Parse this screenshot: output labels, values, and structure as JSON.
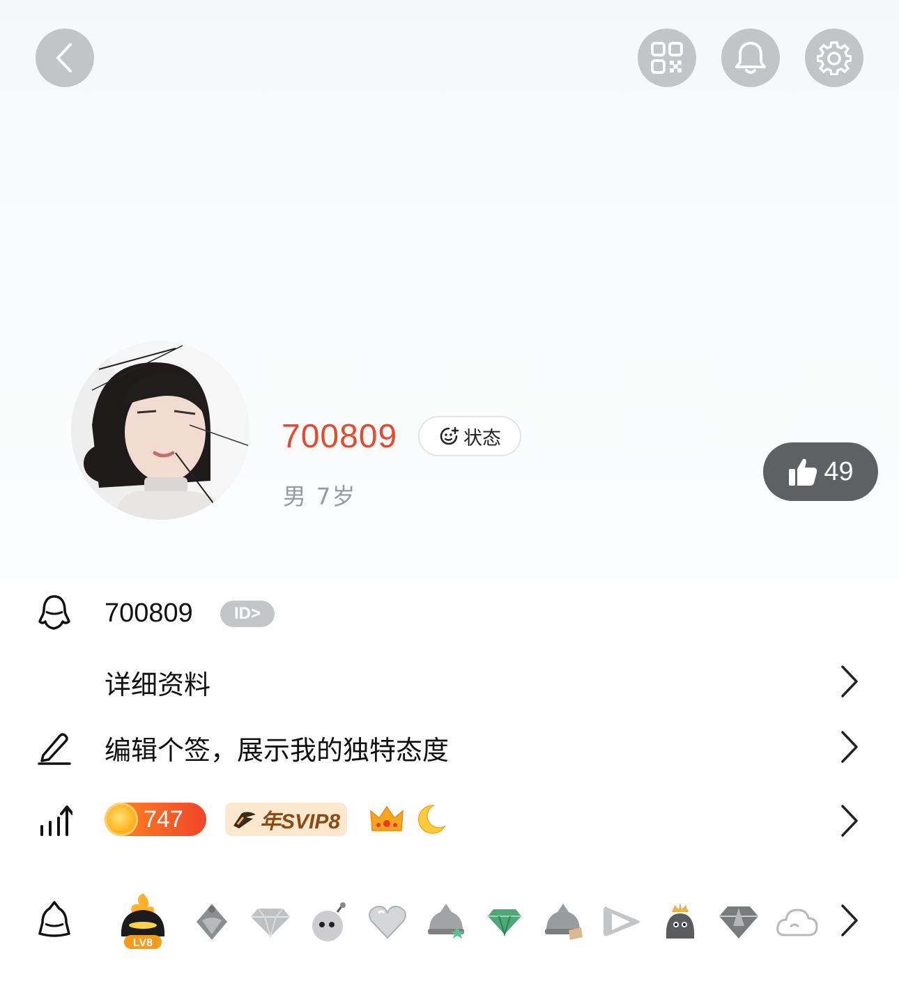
{
  "profile": {
    "nickname": "700809",
    "status_label": "状态",
    "gender_age": "男  7岁",
    "likes": "49"
  },
  "account": {
    "qq_number": "700809",
    "id_badge": "ID>"
  },
  "menu": {
    "details_label": "详细资料",
    "signature_placeholder": "编辑个签，展示我的独特态度"
  },
  "level": {
    "value": "747",
    "svip_label": "年SVIP8"
  },
  "medals": {
    "level_badge_label": "LV8",
    "items": [
      "flame-helmet",
      "gray-helmet",
      "diamond",
      "bomb-face",
      "heart",
      "helmet-star",
      "green-diamond",
      "helmet-book",
      "play",
      "penguin-crown",
      "gem",
      "cloud"
    ]
  },
  "colors": {
    "nickname": "#e8492d",
    "like_pill": "#5f6062",
    "round_button": "#c3c4c6"
  },
  "icons": {
    "back": "back-arrow-icon",
    "qr": "qr-code-icon",
    "bell": "bell-icon",
    "settings": "gear-icon",
    "thumbs": "thumbs-up-icon",
    "qq": "qq-penguin-icon",
    "pen": "pen-icon",
    "growth": "growth-chart-icon",
    "medal": "medal-penguin-icon",
    "chevron": "chevron-right-icon"
  }
}
